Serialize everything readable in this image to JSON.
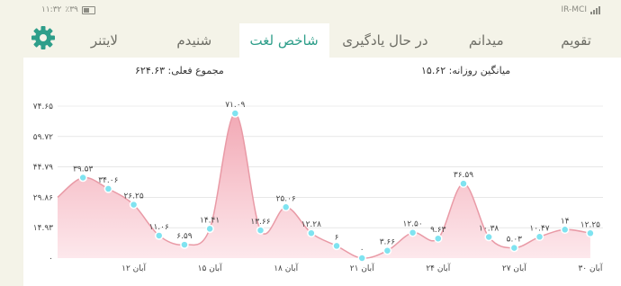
{
  "status": {
    "time": "۱۱:۳۲",
    "battery": "٪۳۹",
    "carrier": "IR-MCI"
  },
  "tabs": [
    {
      "label": "تقویم",
      "active": false
    },
    {
      "label": "میدانم",
      "active": false
    },
    {
      "label": "در حال یادگیری",
      "active": false
    },
    {
      "label": "شاخص لغت",
      "active": true
    },
    {
      "label": "شنیدم",
      "active": false
    },
    {
      "label": "لایتنر",
      "active": false
    }
  ],
  "stats": {
    "average_label": "میانگین روزانه: ۱۵.۶۲",
    "total_label": "مجموع فعلی: ۶۲۴.۶۳"
  },
  "colors": {
    "accent": "#2e9e8a",
    "area": "#f4b8c0",
    "line": "#e99aa6",
    "point": "#7fe3f0"
  },
  "chart_data": {
    "type": "area",
    "yticks": [
      "۰",
      "۱۴.۹۳",
      "۲۹.۸۶",
      "۴۴.۷۹",
      "۵۹.۷۲",
      "۷۴.۶۵"
    ],
    "ylim": [
      0,
      74.65
    ],
    "xticks": [
      "۱۲ آبان",
      "۱۵ آبان",
      "۱۸ آبان",
      "۲۱ آبان",
      "۲۴ آبان",
      "۲۷ آبان",
      "۳۰ آبان"
    ],
    "grid": true,
    "points": [
      {
        "day": 9,
        "value": 29.86,
        "label": ""
      },
      {
        "day": 10,
        "value": 39.53,
        "label": "۳۹.۵۳"
      },
      {
        "day": 11,
        "value": 34.06,
        "label": "۳۴.۰۶"
      },
      {
        "day": 12,
        "value": 26.25,
        "label": "۲۶.۲۵"
      },
      {
        "day": 13,
        "value": 11.06,
        "label": "۱۱.۰۶"
      },
      {
        "day": 14,
        "value": 6.59,
        "label": "۶.۵۹"
      },
      {
        "day": 15,
        "value": 14.41,
        "label": "۱۴.۴۱"
      },
      {
        "day": 16,
        "value": 71.09,
        "label": "۷۱.۰۹"
      },
      {
        "day": 17,
        "value": 13.66,
        "label": "۱۳.۶۶"
      },
      {
        "day": 18,
        "value": 25.06,
        "label": "۲۵.۰۶"
      },
      {
        "day": 19,
        "value": 12.28,
        "label": "۱۲.۲۸"
      },
      {
        "day": 20,
        "value": 6,
        "label": "۶"
      },
      {
        "day": 21,
        "value": 0,
        "label": "۰"
      },
      {
        "day": 22,
        "value": 3.66,
        "label": "۳.۶۶"
      },
      {
        "day": 23,
        "value": 12.5,
        "label": "۱۲.۵۰"
      },
      {
        "day": 24,
        "value": 9.63,
        "label": "۹.۶۳"
      },
      {
        "day": 25,
        "value": 36.59,
        "label": "۳۶.۵۹"
      },
      {
        "day": 26,
        "value": 10.38,
        "label": "۱۰.۳۸"
      },
      {
        "day": 27,
        "value": 5.03,
        "label": "۵.۰۳"
      },
      {
        "day": 28,
        "value": 10.47,
        "label": "۱۰.۴۷"
      },
      {
        "day": 29,
        "value": 14,
        "label": "۱۴"
      },
      {
        "day": 30,
        "value": 12.25,
        "label": "۱۲.۲۵"
      }
    ]
  }
}
